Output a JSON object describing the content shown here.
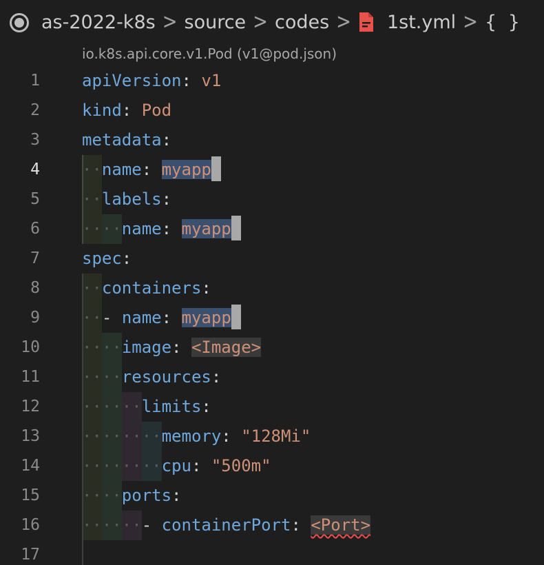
{
  "breadcrumb": {
    "items": [
      "as-2022-k8s",
      "source",
      "codes"
    ],
    "file": "1st.yml",
    "symbol": "{ }",
    "separator": ">"
  },
  "schema_hint": "io.k8s.api.core.v1.Pod (v1@pod.json)",
  "editor": {
    "active_line": 4,
    "lines": [
      {
        "n": "1",
        "tokens": [
          {
            "t": "apiVersion",
            "c": "k"
          },
          {
            "t": ": ",
            "c": "p"
          },
          {
            "t": "v1",
            "c": "v"
          }
        ]
      },
      {
        "n": "2",
        "tokens": [
          {
            "t": "kind",
            "c": "k"
          },
          {
            "t": ": ",
            "c": "p"
          },
          {
            "t": "Pod",
            "c": "v"
          }
        ]
      },
      {
        "n": "3",
        "tokens": [
          {
            "t": "metadata",
            "c": "k"
          },
          {
            "t": ":",
            "c": "p"
          }
        ]
      },
      {
        "n": "4",
        "tokens": [
          {
            "t": "··",
            "c": "dot"
          },
          {
            "t": "name",
            "c": "k"
          },
          {
            "t": ": ",
            "c": "p"
          },
          {
            "t": "myapp",
            "c": "v hl"
          },
          {
            "t": "",
            "c": "cursor"
          }
        ]
      },
      {
        "n": "5",
        "tokens": [
          {
            "t": "··",
            "c": "dot"
          },
          {
            "t": "labels",
            "c": "k"
          },
          {
            "t": ":",
            "c": "p"
          }
        ]
      },
      {
        "n": "6",
        "tokens": [
          {
            "t": "····",
            "c": "dot"
          },
          {
            "t": "name",
            "c": "k"
          },
          {
            "t": ": ",
            "c": "p"
          },
          {
            "t": "myapp",
            "c": "v hl"
          },
          {
            "t": "",
            "c": "cursor"
          }
        ]
      },
      {
        "n": "7",
        "tokens": [
          {
            "t": "spec",
            "c": "k"
          },
          {
            "t": ":",
            "c": "p"
          }
        ]
      },
      {
        "n": "8",
        "tokens": [
          {
            "t": "··",
            "c": "dot"
          },
          {
            "t": "containers",
            "c": "k"
          },
          {
            "t": ":",
            "c": "p"
          }
        ]
      },
      {
        "n": "9",
        "tokens": [
          {
            "t": "··",
            "c": "dot"
          },
          {
            "t": "- ",
            "c": "p"
          },
          {
            "t": "name",
            "c": "k"
          },
          {
            "t": ": ",
            "c": "p"
          },
          {
            "t": "myapp",
            "c": "v hl"
          },
          {
            "t": "",
            "c": "cursor"
          }
        ]
      },
      {
        "n": "10",
        "tokens": [
          {
            "t": "····",
            "c": "dot"
          },
          {
            "t": "image",
            "c": "k"
          },
          {
            "t": ": ",
            "c": "p"
          },
          {
            "t": "<Image>",
            "c": "v placeholder-box"
          }
        ]
      },
      {
        "n": "11",
        "tokens": [
          {
            "t": "····",
            "c": "dot"
          },
          {
            "t": "resources",
            "c": "k"
          },
          {
            "t": ":",
            "c": "p"
          }
        ]
      },
      {
        "n": "12",
        "tokens": [
          {
            "t": "······",
            "c": "dot"
          },
          {
            "t": "limits",
            "c": "k"
          },
          {
            "t": ":",
            "c": "p"
          }
        ]
      },
      {
        "n": "13",
        "tokens": [
          {
            "t": "········",
            "c": "dot"
          },
          {
            "t": "memory",
            "c": "k"
          },
          {
            "t": ": ",
            "c": "p"
          },
          {
            "t": "\"128Mi\"",
            "c": "v"
          }
        ]
      },
      {
        "n": "14",
        "tokens": [
          {
            "t": "········",
            "c": "dot"
          },
          {
            "t": "cpu",
            "c": "k"
          },
          {
            "t": ": ",
            "c": "p"
          },
          {
            "t": "\"500m\"",
            "c": "v"
          }
        ]
      },
      {
        "n": "15",
        "tokens": [
          {
            "t": "····",
            "c": "dot"
          },
          {
            "t": "ports",
            "c": "k"
          },
          {
            "t": ":",
            "c": "p"
          }
        ]
      },
      {
        "n": "16",
        "tokens": [
          {
            "t": "······",
            "c": "dot"
          },
          {
            "t": "- ",
            "c": "p"
          },
          {
            "t": "containerPort",
            "c": "k"
          },
          {
            "t": ": ",
            "c": "p"
          },
          {
            "t": "<Port>",
            "c": "v placeholder-box squiggle"
          }
        ]
      },
      {
        "n": "17",
        "tokens": []
      }
    ]
  },
  "colors": {
    "background": "#1e1e1e",
    "key": "#6fa8dc",
    "value": "#ce9178",
    "error_squiggle": "#f14c4c"
  }
}
